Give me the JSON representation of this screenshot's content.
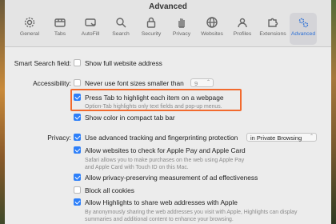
{
  "window": {
    "title": "Advanced"
  },
  "tabs": [
    {
      "label": "General",
      "icon": "gear-icon"
    },
    {
      "label": "Tabs",
      "icon": "tabs-icon"
    },
    {
      "label": "AutoFill",
      "icon": "autofill-icon"
    },
    {
      "label": "Search",
      "icon": "search-icon"
    },
    {
      "label": "Security",
      "icon": "lock-icon"
    },
    {
      "label": "Privacy",
      "icon": "hand-icon"
    },
    {
      "label": "Websites",
      "icon": "globe-icon"
    },
    {
      "label": "Profiles",
      "icon": "profile-icon"
    },
    {
      "label": "Extensions",
      "icon": "puzzle-icon"
    },
    {
      "label": "Advanced",
      "icon": "gears-icon",
      "active": true
    }
  ],
  "smart_search": {
    "label": "Smart Search field:",
    "show_full_address": {
      "text": "Show full website address",
      "checked": false
    }
  },
  "accessibility": {
    "label": "Accessibility:",
    "font_size": {
      "text": "Never use font sizes smaller than",
      "checked": false,
      "value": "9"
    },
    "press_tab": {
      "text": "Press Tab to highlight each item on a webpage",
      "checked": true,
      "description": "Option-Tab highlights only text fields and pop-up menus."
    },
    "compact_color": {
      "text": "Show color in compact tab bar",
      "checked": true
    }
  },
  "privacy": {
    "label": "Privacy:",
    "advanced_tracking": {
      "text": "Use advanced tracking and fingerprinting protection",
      "checked": true,
      "select_value": "in Private Browsing"
    },
    "apple_pay": {
      "text": "Allow websites to check for Apple Pay and Apple Card",
      "checked": true,
      "description_lines": [
        "Safari allows you to make purchases on the web using Apple Pay",
        "and Apple Card with Touch ID on this Mac."
      ]
    },
    "ad_measurement": {
      "text": "Allow privacy-preserving measurement of ad effectiveness",
      "checked": true
    },
    "block_cookies": {
      "text": "Block all cookies",
      "checked": false
    },
    "highlights": {
      "text": "Allow Highlights to share web addresses with Apple",
      "checked": true,
      "description_lines": [
        "By anonymously sharing the web addresses you visit with Apple, Highlights can display",
        "summaries and additional content to enhance your browsing."
      ]
    }
  },
  "colors": {
    "accent": "#2d7ff9",
    "highlight_border": "#f26a2e",
    "active_tab_text": "#2b6fd6"
  }
}
